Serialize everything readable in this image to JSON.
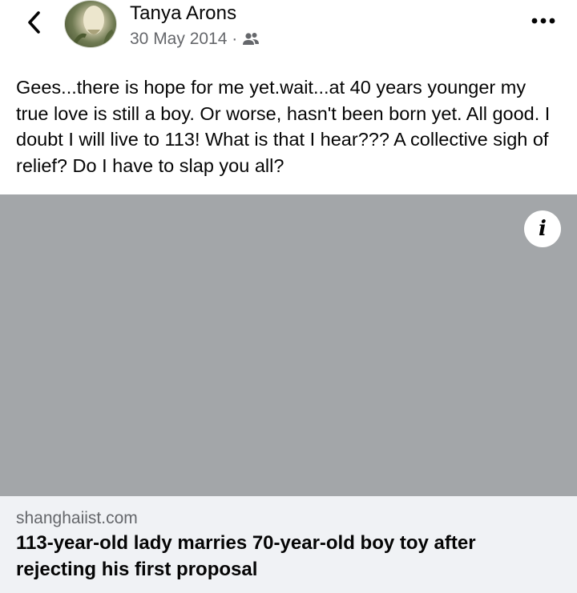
{
  "post": {
    "author": "Tanya Arons",
    "date": "30 May 2014 ·",
    "audience_icon": "friends-icon",
    "text": "Gees...there is hope for me yet.wait...at 40 years younger my true love is still a boy.  Or worse, hasn't been born yet.  All good.  I doubt I will live to 113!  What is that I hear???  A collective sigh of relief?  Do I have to slap you all?"
  },
  "link_preview": {
    "domain": "shanghaiist.com",
    "title": "113-year-old lady marries 70-year-old boy toy after rejecting his first proposal",
    "info_label": "i"
  },
  "icons": {
    "back": "chevron-left-icon",
    "more": "more-horizontal-icon",
    "info": "info-icon"
  },
  "colors": {
    "text_primary": "#050505",
    "text_secondary": "#65676b",
    "preview_image_bg": "#a3a6a9",
    "preview_footer_bg": "#f0f2f5"
  }
}
